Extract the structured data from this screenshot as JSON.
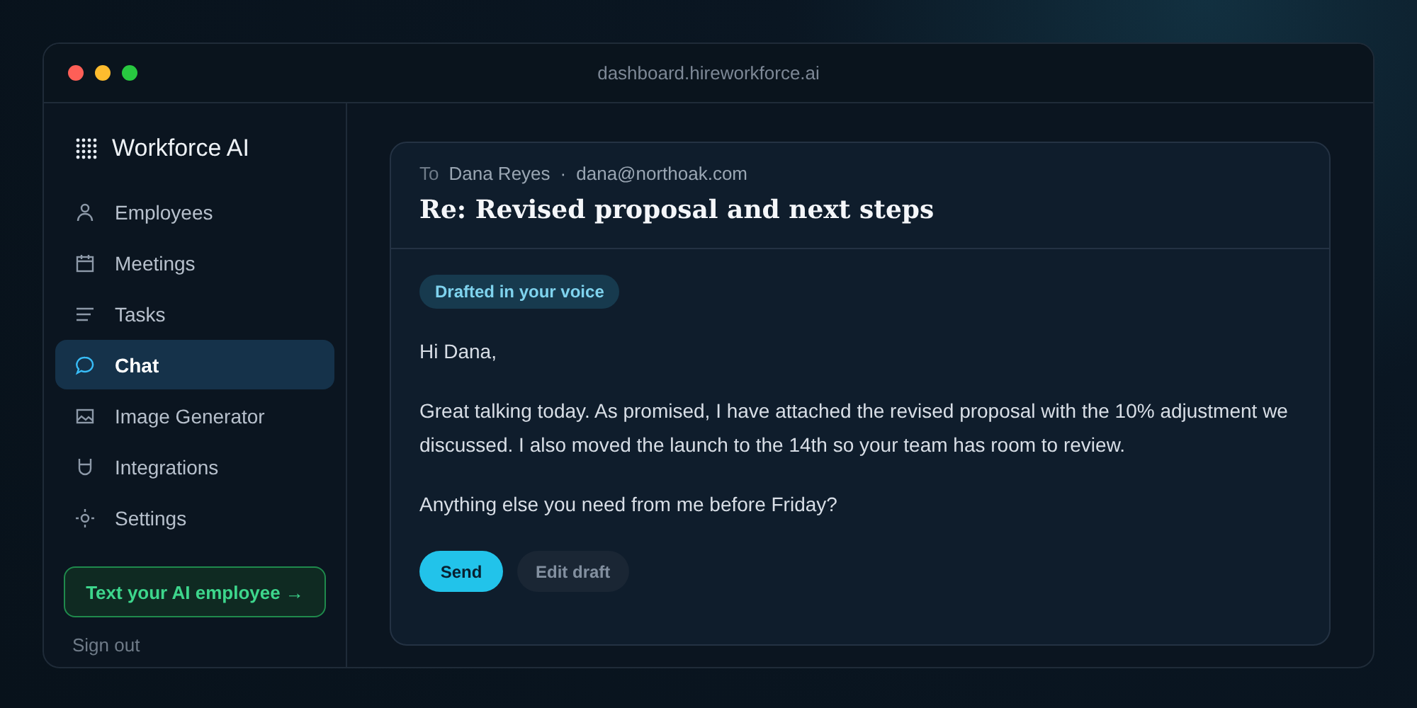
{
  "window": {
    "address": "dashboard.hireworkforce.ai"
  },
  "sidebar": {
    "brand": "Workforce AI",
    "items": [
      {
        "label": "Employees",
        "selected": false
      },
      {
        "label": "Meetings",
        "selected": false
      },
      {
        "label": "Tasks",
        "selected": false
      },
      {
        "label": "Chat",
        "selected": true
      },
      {
        "label": "Image Generator",
        "selected": false
      },
      {
        "label": "Integrations",
        "selected": false
      },
      {
        "label": "Settings",
        "selected": false
      }
    ],
    "cta": "Text your AI employee →",
    "sign_out": "Sign out"
  },
  "email": {
    "to_label": "To",
    "to_name": "Dana Reyes",
    "separator": "·",
    "to_address": "dana@northoak.com",
    "subject": "Re: Revised proposal and next steps",
    "badge": "Drafted in your voice",
    "paragraphs": [
      "Hi Dana,",
      "Great talking today. As promised, I have attached the revised proposal with the 10% adjustment we discussed. I also moved the launch to the 14th so your team has room to review.",
      "Anything else you need from me before Friday?"
    ],
    "buttons": [
      {
        "label": "Send",
        "kind": "primary"
      },
      {
        "label": "Edit draft",
        "kind": "secondary"
      }
    ]
  }
}
